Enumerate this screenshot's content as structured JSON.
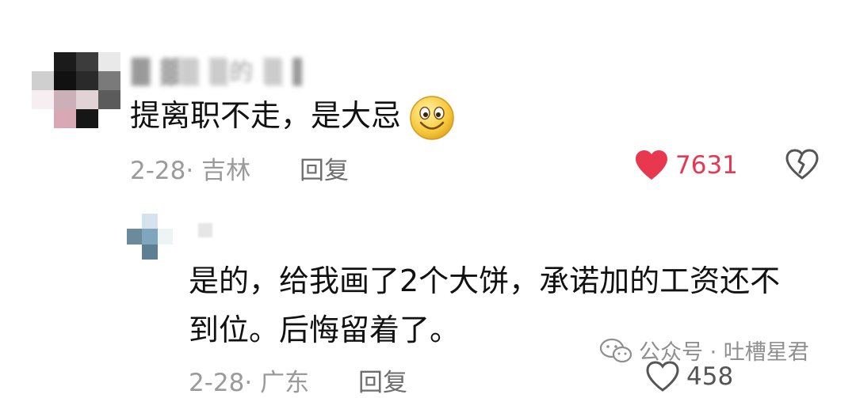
{
  "comment": {
    "username": "█ ▓▒ ▒的 ▒ ▌",
    "text": "提离职不走，是大忌",
    "date_location": "2-28· 吉林",
    "reply_label": "回复",
    "like_count": "7631",
    "liked": true
  },
  "reply": {
    "username": "▒",
    "text_line1": "是的，给我画了2个大饼，承诺加的工资还不",
    "text_line2": "到位。后悔留着了。",
    "date_location": "2-28· 广东",
    "reply_label": "回复",
    "like_count": "458",
    "liked": false
  },
  "watermark": {
    "label": "公众号 · 吐槽星君",
    "icon": "wechat-icon"
  },
  "icons": {
    "emoji": "smiley-emoji-icon",
    "like_filled": "heart-filled-icon",
    "like_outline": "heart-outline-icon",
    "dislike": "broken-heart-icon"
  },
  "colors": {
    "like_red": "#e8384f",
    "meta_gray": "#9a9a9a",
    "text": "#111111"
  }
}
